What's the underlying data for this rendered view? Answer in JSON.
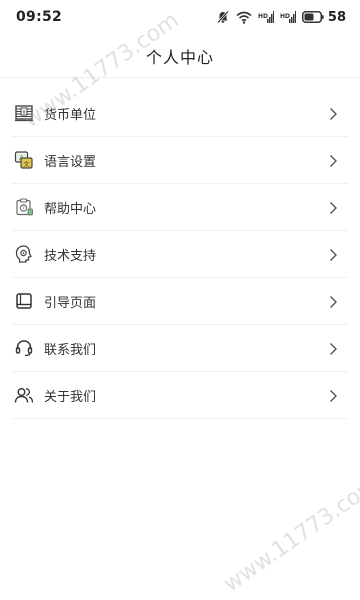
{
  "status_bar": {
    "time": "09:52",
    "battery": "58"
  },
  "header": {
    "title": "个人中心"
  },
  "menu": {
    "items": [
      {
        "label": "货币单位",
        "icon": "currency-icon"
      },
      {
        "label": "语言设置",
        "icon": "language-icon"
      },
      {
        "label": "帮助中心",
        "icon": "help-icon"
      },
      {
        "label": "技术支持",
        "icon": "support-icon"
      },
      {
        "label": "引导页面",
        "icon": "guide-icon"
      },
      {
        "label": "联系我们",
        "icon": "headset-icon"
      },
      {
        "label": "关于我们",
        "icon": "users-icon"
      }
    ]
  },
  "watermark": {
    "text": "www.11773.com"
  },
  "colors": {
    "icon_stroke": "#444444",
    "accent_yellow": "#e8c84a",
    "accent_green": "#7bbf8a",
    "divider": "#f0f0f0"
  }
}
